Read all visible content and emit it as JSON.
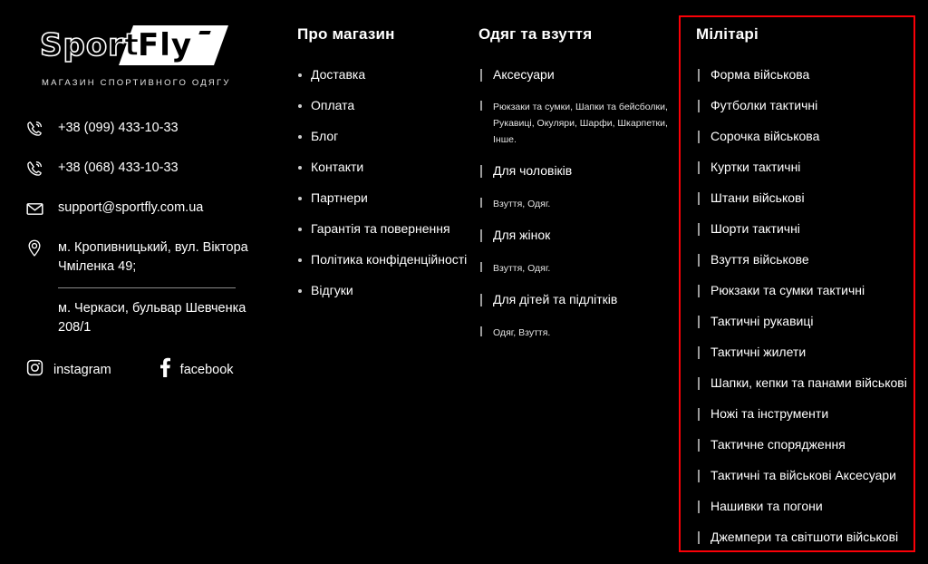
{
  "brand": {
    "logo_word_1": "Sport",
    "logo_word_2": "Fly",
    "tagline": "магазин спортивного одягу"
  },
  "contacts": {
    "phone_primary": "+38 (099) 433-10-33",
    "phone_secondary": "+38 (068) 433-10-33",
    "email": "support@sportfly.com.ua",
    "address_primary": "м. Кропивницький, вул. Віктора Чміленка 49;",
    "address_secondary": "м. Черкаси, бульвар Шевченка 208/1",
    "icons": {
      "phone": "phone-icon",
      "mail": "mail-icon",
      "location": "location-pin-icon"
    }
  },
  "social": [
    {
      "name": "instagram",
      "label": "instagram",
      "icon": "instagram-icon"
    },
    {
      "name": "facebook",
      "label": "facebook",
      "icon": "facebook-icon"
    }
  ],
  "columns": {
    "about": {
      "title": "Про магазин",
      "items": [
        "Доставка",
        "Оплата",
        "Блог",
        "Контакти",
        "Партнери",
        "Гарантія та повернення",
        "Політика конфіденційності",
        "Відгуки"
      ]
    },
    "clothing": {
      "title": "Одяг та взуття",
      "items": [
        {
          "label": "Аксесуари",
          "type": "main"
        },
        {
          "label": "Рюкзаки та сумки, Шапки та бейсболки, Рукавиці, Окуляри, Шарфи, Шкарпетки, Інше.",
          "type": "sub"
        },
        {
          "label": "Для чоловіків",
          "type": "main"
        },
        {
          "label": "Взуття, Одяг.",
          "type": "sub"
        },
        {
          "label": "Для жінок",
          "type": "main"
        },
        {
          "label": "Взуття, Одяг.",
          "type": "sub"
        },
        {
          "label": "Для дітей та підлітків",
          "type": "main"
        },
        {
          "label": "Одяг, Взуття.",
          "type": "sub"
        }
      ]
    },
    "military": {
      "title": "Мілітарі",
      "highlighted": true,
      "highlight_color": "#fb0007",
      "items": [
        "Форма військова",
        "Футболки тактичні",
        "Сорочка військова",
        "Куртки тактичні",
        "Штани військові",
        "Шорти тактичні",
        "Взуття військове",
        "Рюкзаки та сумки тактичні",
        "Тактичні рукавиці",
        "Тактичні жилети",
        "Шапки, кепки та панами військові",
        "Ножі та інструменти",
        "Тактичне спорядження",
        "Тактичні та військові Аксесуари",
        "Нашивки та погони",
        "Джемпери та світшоти військові"
      ]
    }
  },
  "theme": {
    "background": "#000000",
    "text": "#ffffff",
    "muted": "#cfcfcf",
    "accent": "#fb0007"
  }
}
